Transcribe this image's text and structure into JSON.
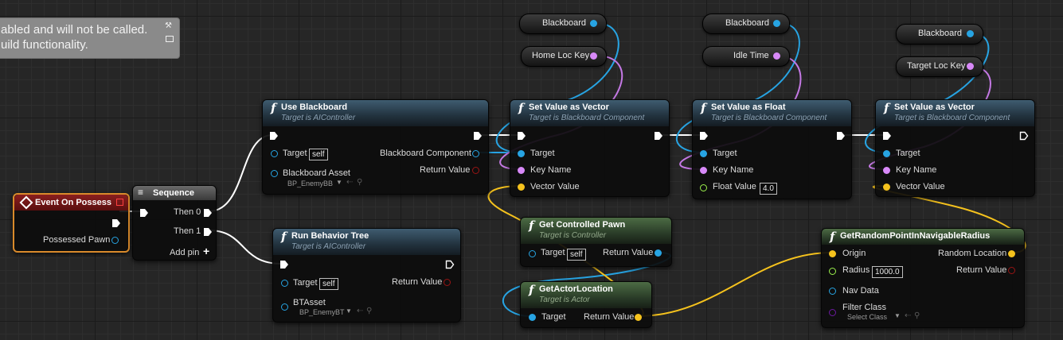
{
  "comment": {
    "line1": "abled and will not be called.",
    "line2": "uild functionality."
  },
  "colors": {
    "object_pin": "#27a4e3",
    "name_pin": "#d889f8",
    "vector_pin": "#f5c21d",
    "float_pin": "#9cf14c",
    "bool_pin": "#9a1414",
    "exec_pin": "#ffffff",
    "class_pin": "#6c1ba1"
  },
  "nodes": {
    "event_on_possess": {
      "title": "Event On Possess",
      "possessed_pawn": "Possessed Pawn"
    },
    "sequence": {
      "title": "Sequence",
      "then0": "Then 0",
      "then1": "Then 1",
      "add_pin": "Add pin"
    },
    "use_blackboard": {
      "title": "Use Blackboard",
      "subtitle": "Target is AIController",
      "target": "Target",
      "target_value": "self",
      "blackboard_asset": "Blackboard Asset",
      "asset_value": "BP_EnemyBB",
      "blackboard_component": "Blackboard Component",
      "return_value": "Return Value"
    },
    "run_behavior_tree": {
      "title": "Run Behavior Tree",
      "subtitle": "Target is AIController",
      "target": "Target",
      "target_value": "self",
      "btasset": "BTAsset",
      "btasset_value": "BP_EnemyBT",
      "return_value": "Return Value"
    },
    "set_value_as_vector_1": {
      "title": "Set Value as Vector",
      "subtitle": "Target is Blackboard Component",
      "target": "Target",
      "key_name": "Key Name",
      "vector_value": "Vector Value"
    },
    "set_value_as_float": {
      "title": "Set Value as Float",
      "subtitle": "Target is Blackboard Component",
      "target": "Target",
      "key_name": "Key Name",
      "float_value": "Float Value",
      "float_input": "4.0"
    },
    "set_value_as_vector_2": {
      "title": "Set Value as Vector",
      "subtitle": "Target is Blackboard Component",
      "target": "Target",
      "key_name": "Key Name",
      "vector_value": "Vector Value"
    },
    "get_controlled_pawn": {
      "title": "Get Controlled Pawn",
      "subtitle": "Target is Controller",
      "target": "Target",
      "target_value": "self",
      "return_value": "Return Value"
    },
    "get_actor_location": {
      "title": "GetActorLocation",
      "subtitle": "Target is Actor",
      "target": "Target",
      "return_value": "Return Value"
    },
    "get_random_point": {
      "title": "GetRandomPointInNavigableRadius",
      "origin": "Origin",
      "radius": "Radius",
      "radius_value": "1000.0",
      "nav_data": "Nav Data",
      "filter_class": "Filter Class",
      "filter_value": "Select Class",
      "random_location": "Random Location",
      "return_value": "Return Value"
    }
  },
  "variables": {
    "blackboard_1": "Blackboard",
    "home_loc_key": "Home Loc Key",
    "blackboard_2": "Blackboard",
    "idle_time": "Idle Time",
    "blackboard_3": "Blackboard",
    "target_loc_key": "Target Loc Key"
  }
}
